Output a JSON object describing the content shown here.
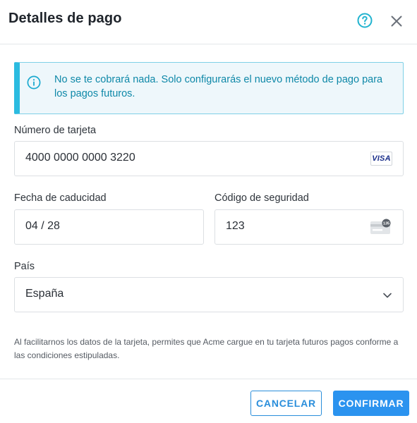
{
  "dialog": {
    "title": "Detalles de pago",
    "help_icon": "question-circle-icon",
    "close_icon": "close-icon"
  },
  "notice": {
    "icon": "info-circle-icon",
    "text": "No se te cobrará nada. Solo configurarás el nuevo método de pago para los pagos futuros."
  },
  "card_number": {
    "label": "Número de tarjeta",
    "value": "4000 0000 0000 3220",
    "brand": "VISA"
  },
  "expiry": {
    "label": "Fecha de caducidad",
    "value": "04 / 28"
  },
  "security_code": {
    "label": "Código de seguridad",
    "value": "123",
    "icon_hint": "135"
  },
  "country": {
    "label": "País",
    "selected": "España"
  },
  "disclaimer": "Al facilitarnos los datos de la tarjeta, permites que Acme cargue en tu tarjeta futuros pagos conforme a las condiciones estipuladas.",
  "buttons": {
    "cancel": "CANCELAR",
    "confirm": "CONFIRMAR"
  },
  "colors": {
    "accent": "#2b93ef",
    "info_border": "#2bbbe0",
    "info_background": "#eef7fb",
    "info_text": "#0e88a8"
  }
}
